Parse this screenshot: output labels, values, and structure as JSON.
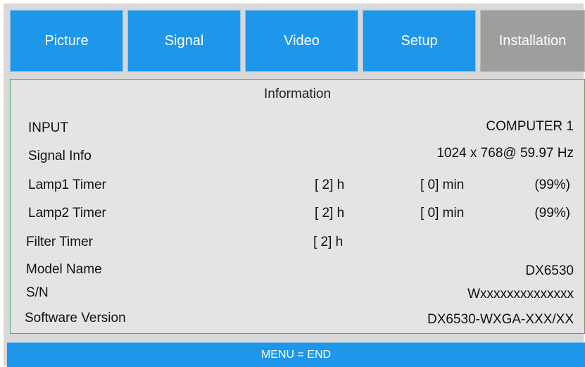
{
  "tabs": [
    {
      "label": "Picture",
      "active": false
    },
    {
      "label": "Signal",
      "active": false
    },
    {
      "label": "Video",
      "active": false
    },
    {
      "label": "Setup",
      "active": false
    },
    {
      "label": "Installation",
      "active": true
    }
  ],
  "panel": {
    "title": "Information",
    "input": {
      "label": "INPUT",
      "value": "COMPUTER 1"
    },
    "signal_info": {
      "label": "Signal Info",
      "value": "1024 x 768@ 59.97 Hz"
    },
    "lamp1": {
      "label": "Lamp1 Timer",
      "hours": "[ 2] h",
      "minutes": "[ 0] min",
      "percent": "(99%)"
    },
    "lamp2": {
      "label": "Lamp2 Timer",
      "hours": "[ 2] h",
      "minutes": "[ 0] min",
      "percent": "(99%)"
    },
    "filter": {
      "label": "Filter Timer",
      "hours": "[ 2] h"
    },
    "model_name": {
      "label": "Model Name",
      "value": "DX6530"
    },
    "serial": {
      "label": "S/N",
      "value": "Wxxxxxxxxxxxxxx"
    },
    "software": {
      "label": "Software Version",
      "value": "DX6530-WXGA-XXX/XX"
    }
  },
  "footer": {
    "text": "MENU = END"
  },
  "colors": {
    "tab_blue": "#1e96ea",
    "tab_active_gray": "#9e9e9e",
    "panel_border_green": "#4fa86a"
  }
}
